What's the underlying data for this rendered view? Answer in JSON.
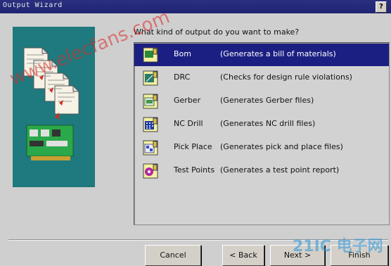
{
  "window": {
    "title": "Output Wizard",
    "help_label": "?"
  },
  "prompt": "What kind of output do you want to make?",
  "options": [
    {
      "name": "Bom",
      "description": "(Generates a bill of materials)",
      "icon": "bom-icon",
      "selected": true
    },
    {
      "name": "DRC",
      "description": "(Checks for design rule violations)",
      "icon": "drc-icon",
      "selected": false
    },
    {
      "name": "Gerber",
      "description": "(Generates Gerber files)",
      "icon": "gerber-icon",
      "selected": false
    },
    {
      "name": "NC Drill",
      "description": "(Generates NC drill files)",
      "icon": "nc-drill-icon",
      "selected": false
    },
    {
      "name": "Pick Place",
      "description": "(Generates pick and place files)",
      "icon": "pick-place-icon",
      "selected": false
    },
    {
      "name": "Test Points",
      "description": "(Generates a test point report)",
      "icon": "test-points-icon",
      "selected": false
    }
  ],
  "buttons": {
    "cancel": "Cancel",
    "back": "< Back",
    "next": "Next >",
    "finish": "Finish"
  },
  "watermark": {
    "diagonal": "www.elecfans.com",
    "corner": "21IC 电子网"
  },
  "colors": {
    "selection": "#1c1f82",
    "panel": "#1e7a7e",
    "titlebar": "#1e2474"
  }
}
